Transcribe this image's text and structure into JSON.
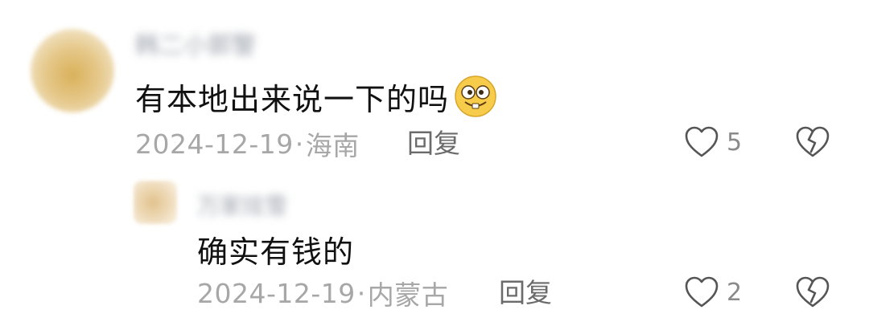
{
  "comments": [
    {
      "username": "韩二小郭警",
      "text": "有本地出来说一下的吗",
      "emoji_icon": "grinning-face-emoji",
      "date": "2024-12-19",
      "location": "海南",
      "reply_label": "回复",
      "like_count": "5"
    },
    {
      "username": "万家炫雪",
      "text": "确实有钱的",
      "date": "2024-12-19",
      "location": "内蒙古",
      "reply_label": "回复",
      "like_count": "2"
    }
  ],
  "separator": "·",
  "colors": {
    "text": "#111111",
    "meta": "#a7a7a7",
    "icon": "#555555"
  }
}
